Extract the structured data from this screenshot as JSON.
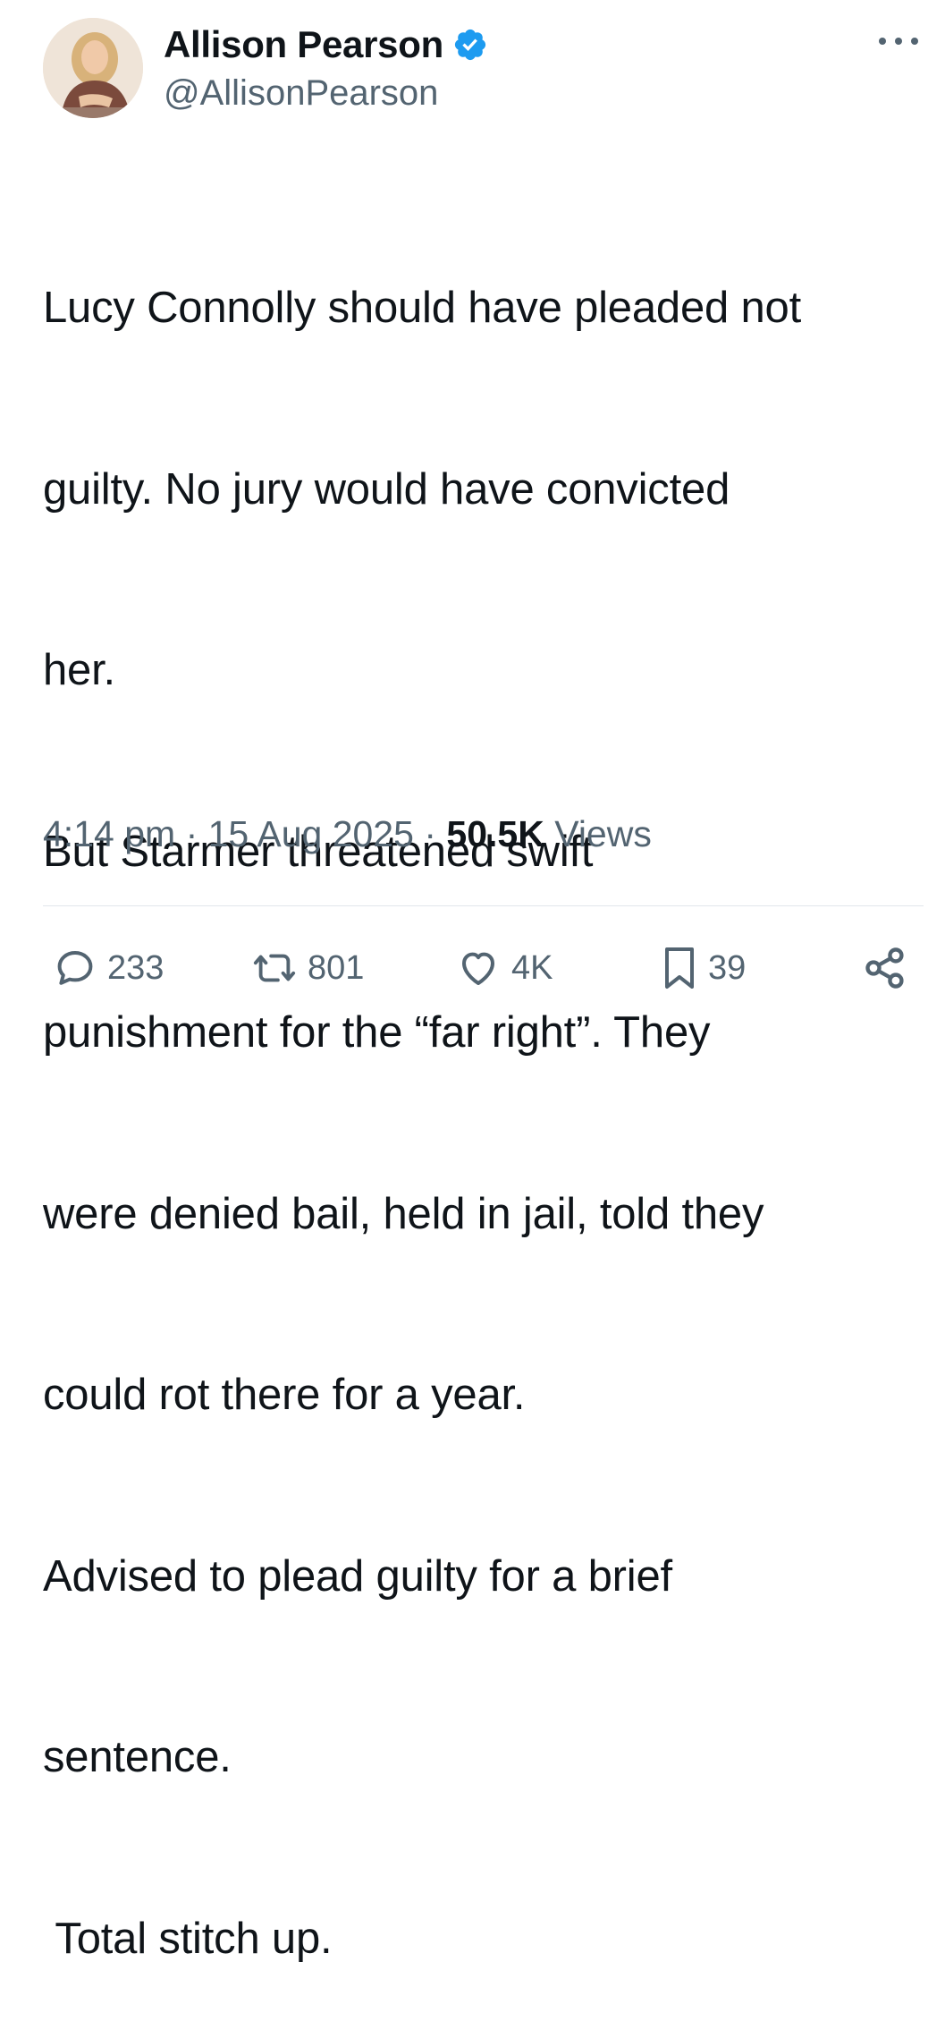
{
  "author": {
    "display_name": "Allison Pearson",
    "handle": "@AllisonPearson",
    "verified": true
  },
  "tweet": {
    "lines": [
      "Lucy Connolly should have pleaded not",
      "guilty. No jury would have convicted",
      "her.",
      "But Starmer threatened swift",
      "punishment for the “far right”. They",
      "were denied bail, held in jail, told they",
      "could rot there for a year.",
      "Advised to plead guilty for a brief",
      "sentence.",
      " Total stitch up."
    ]
  },
  "meta": {
    "time": "4:14 pm",
    "separator": "·",
    "date": "15 Aug 2025",
    "views_count": "50.5K",
    "views_label": "Views"
  },
  "actions": {
    "replies": "233",
    "reposts": "801",
    "likes": "4K",
    "bookmarks": "39"
  },
  "colors": {
    "text": "#0f1419",
    "secondary": "#536471",
    "verified": "#1d9bf0",
    "divider": "#e1e7eb"
  }
}
